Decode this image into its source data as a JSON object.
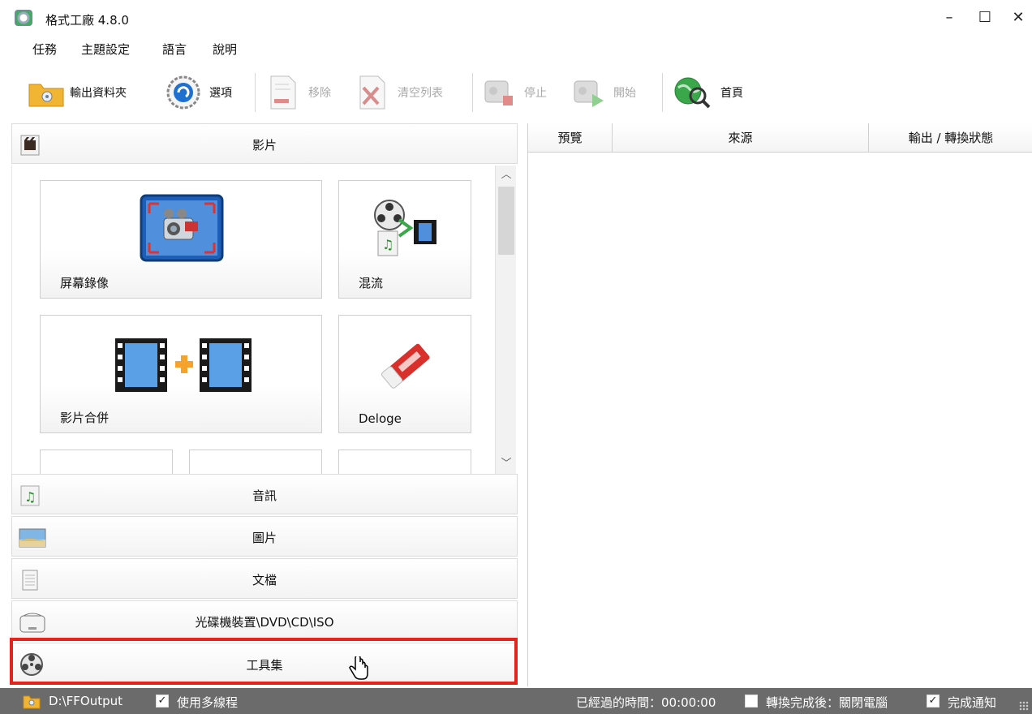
{
  "window": {
    "title": "格式工廠 4.8.0",
    "min": "–",
    "max": "☐",
    "close": "✕"
  },
  "menu": [
    "任務",
    "主題設定",
    "語言",
    "說明"
  ],
  "toolbar": {
    "output_folder": "輸出資料夾",
    "options": "選項",
    "remove": "移除",
    "clear_list": "清空列表",
    "stop": "停止",
    "start": "開始",
    "home": "首頁"
  },
  "categories": {
    "video": "影片",
    "audio": "音訊",
    "picture": "圖片",
    "document": "文檔",
    "rom": "光碟機裝置\\DVD\\CD\\ISO",
    "utilities": "工具集"
  },
  "tiles": {
    "screen_record": "屏幕錄像",
    "mux": "混流",
    "video_join": "影片合併",
    "deloge": "Deloge"
  },
  "columns": {
    "preview": "預覽",
    "source": "來源",
    "output_status": "輸出 / 轉換狀態"
  },
  "status": {
    "folder": "D:\\FFOutput",
    "multithread": "使用多線程",
    "elapsed": "已經過的時間：00:00:00",
    "after_convert": "轉換完成後：關閉電腦",
    "notify": "完成通知"
  }
}
